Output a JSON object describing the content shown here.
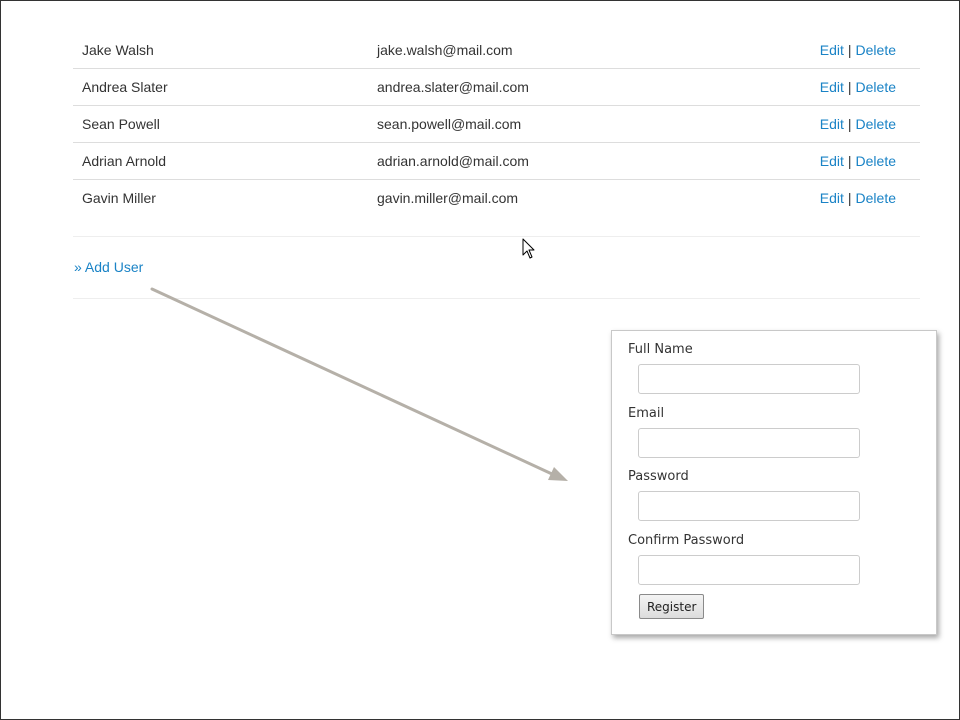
{
  "users": [
    {
      "name": "Jake Walsh",
      "email": "jake.walsh@mail.com"
    },
    {
      "name": "Andrea Slater",
      "email": "andrea.slater@mail.com"
    },
    {
      "name": "Sean Powell",
      "email": "sean.powell@mail.com"
    },
    {
      "name": "Adrian Arnold",
      "email": "adrian.arnold@mail.com"
    },
    {
      "name": "Gavin Miller",
      "email": "gavin.miller@mail.com"
    }
  ],
  "actions": {
    "edit_label": "Edit",
    "separator": "|",
    "delete_label": "Delete"
  },
  "add_user_label": "» Add User",
  "form": {
    "full_name_label": "Full Name",
    "full_name_value": "",
    "email_label": "Email",
    "email_value": "",
    "password_label": "Password",
    "password_value": "",
    "confirm_password_label": "Confirm Password",
    "confirm_password_value": "",
    "register_label": "Register"
  },
  "colors": {
    "link": "#1a83c6",
    "text": "#333333",
    "row_border": "#dddddd",
    "arrow": "#b5b0a8"
  },
  "icons": {
    "cursor": "mouse-pointer-icon",
    "annotation": "annotation-arrow-icon"
  }
}
